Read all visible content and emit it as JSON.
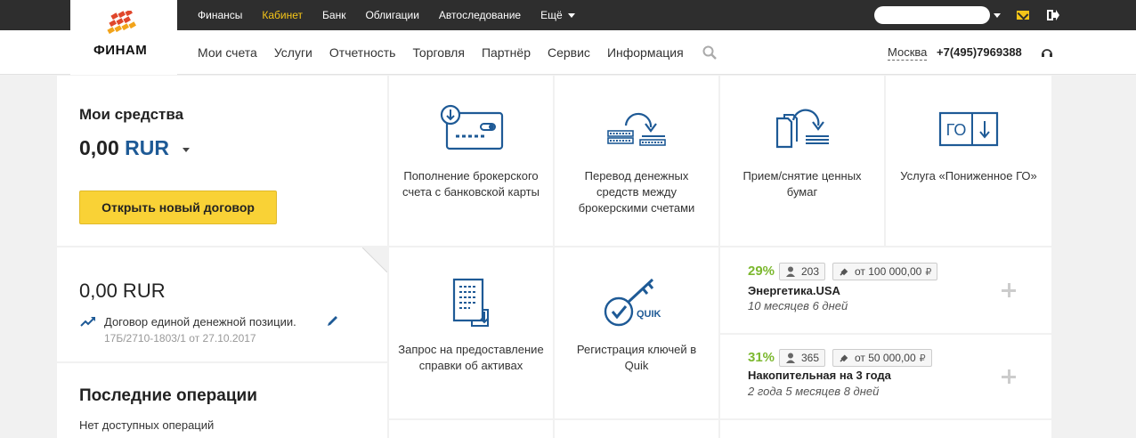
{
  "top_nav": {
    "items": [
      {
        "label": "Финансы",
        "active": false
      },
      {
        "label": "Кабинет",
        "active": true
      },
      {
        "label": "Банк",
        "active": false
      },
      {
        "label": "Облигации",
        "active": false
      },
      {
        "label": "Автоследование",
        "active": false
      },
      {
        "label": "Ещё",
        "active": false
      }
    ]
  },
  "logo": {
    "text": "ФИНАМ"
  },
  "main_nav": {
    "items": [
      "Мои счета",
      "Услуги",
      "Отчетность",
      "Торговля",
      "Партнёр",
      "Сервис",
      "Информация"
    ]
  },
  "header_contact": {
    "city": "Москва",
    "phone": "+7(495)7969388"
  },
  "funds": {
    "title": "Мои средства",
    "amount": "0,00",
    "currency": "RUR",
    "open_button": "Открыть новый договор"
  },
  "account": {
    "amount": "0,00 RUR",
    "name": "Договор единой денежной позиции.",
    "number": "17Б/2710-1803/1 от 27.10.2017"
  },
  "operations": {
    "title": "Последние операции",
    "empty_text": "Нет доступных операций"
  },
  "tiles": [
    {
      "label": "Пополнение брокерского счета с банковской карты",
      "icon": "card-deposit-icon"
    },
    {
      "label": "Перевод денежных средств между брокерскими счетами",
      "icon": "transfer-icon"
    },
    {
      "label": "Прием/снятие ценных бумаг",
      "icon": "securities-icon"
    },
    {
      "label": "Услуга «Пониженное ГО»",
      "icon": "go-icon",
      "icon_text": "ГО"
    },
    {
      "label": "Запрос на предоставление справки об активах",
      "icon": "document-icon"
    },
    {
      "label": "Регистрация ключей в Quik",
      "icon": "quik-key-icon",
      "icon_text": "QUIK"
    }
  ],
  "products": [
    {
      "percent": "29%",
      "users": "203",
      "min_amount": "от 100 000,00",
      "name": "Энергетика.USA",
      "term": "10 месяцев 6 дней"
    },
    {
      "percent": "31%",
      "users": "365",
      "min_amount": "от 50 000,00",
      "name": "Накопительная на 3 года",
      "term": "2 года 5 месяцев 8 дней"
    }
  ],
  "colors": {
    "topbar": "#2e2e2e",
    "accent_yellow": "#f9d236",
    "nav_active": "#f5c518",
    "icon_blue": "#1e5a96",
    "percent_green": "#7cb82f"
  }
}
